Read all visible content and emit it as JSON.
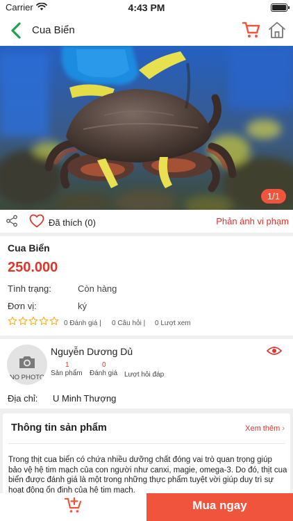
{
  "status_bar": {
    "carrier": "Carrier",
    "time": "4:43 PM",
    "wifi_icon": "wifi-icon",
    "battery_icon": "battery-icon"
  },
  "nav": {
    "title": "Cua Biển",
    "back_icon": "chevron-left-icon",
    "cart_icon": "cart-icon",
    "home_icon": "home-icon"
  },
  "gallery": {
    "counter": "1/1"
  },
  "actions": {
    "like_label": "Đã thích (0)",
    "report_label": "Phản ánh vi phạm",
    "share_icon": "share-icon",
    "heart_icon": "heart-icon"
  },
  "product": {
    "name": "Cua Biển",
    "price": "250.000",
    "status_label": "Tình trạng:",
    "status_value": "Còn hàng",
    "unit_label": "Đơn vị:",
    "unit_value": "ký",
    "rating_stars": 0,
    "reviews": "0 Đánh giá |",
    "questions": "0 Câu hỏi |",
    "views": "0 Lượt xem"
  },
  "seller": {
    "avatar_text": "NO PHOTO",
    "name": "Nguyễn Dương Dủ",
    "products_count": "1",
    "products_label": "Sản phẩm",
    "reviews_count": "0",
    "reviews_label": "Đánh giá",
    "answers_label": "Lượt hỏi đáp",
    "address_label": "Địa chỉ:",
    "address_value": "U Minh Thượng"
  },
  "details": {
    "title": "Thông tin sản phẩm",
    "see_more": "Xem thêm",
    "description": "Trong thịt cua biển có chứa nhiều dưỡng chất đóng vai trò quan trọng giúp bảo vệ hệ tim mạch của con người như canxi, magie, omega-3. Do đó, thịt cua biển được đánh giá là một trong những thực phẩm tuyệt vời giúp duy trì sự hoạt động ổn định của hệ tim mạch."
  },
  "bottom": {
    "buy_now": "Mua ngay",
    "add_cart_icon": "add-to-cart-icon"
  },
  "colors": {
    "accent": "#f0543c",
    "red_text": "#e0332a",
    "back_green": "#1fa34a",
    "star": "#f2b01e"
  }
}
